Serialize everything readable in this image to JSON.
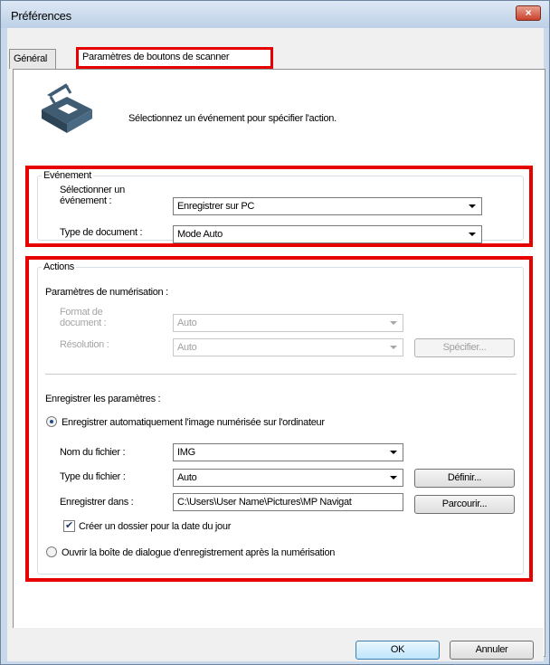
{
  "window": {
    "title": "Préférences",
    "close_symbol": "×"
  },
  "tabs": [
    {
      "label": "Général"
    },
    {
      "label": "Paramètres de boutons de scanner"
    }
  ],
  "intro_text": "Sélectionnez un événement pour spécifier l'action.",
  "event_group": {
    "title": "Evénement",
    "select_event_label_1": "Sélectionner un",
    "select_event_label_2": "événement :",
    "select_event_value": "Enregistrer sur PC",
    "doc_type_label": "Type de document :",
    "doc_type_value": "Mode Auto"
  },
  "actions_group": {
    "title": "Actions",
    "scan_settings_label": "Paramètres de numérisation :",
    "doc_format_label_1": "Format de",
    "doc_format_label_2": "document :",
    "doc_format_value": "Auto",
    "resolution_label": "Résolution :",
    "resolution_value": "Auto",
    "specify_button": "Spécifier...",
    "save_settings_label": "Enregistrer les paramètres :",
    "auto_save_radio": "Enregistrer automatiquement l'image numérisée sur l'ordinateur",
    "file_name_label": "Nom du fichier :",
    "file_name_value": "IMG",
    "file_type_label": "Type du fichier :",
    "file_type_value": "Auto",
    "define_button": "Définir...",
    "save_in_label": "Enregistrer dans :",
    "save_in_value": "C:\\Users\\User Name\\Pictures\\MP Navigat",
    "browse_button": "Parcourir...",
    "date_folder_checkbox": "Créer un dossier pour la date du jour",
    "date_folder_checked": true,
    "open_dialog_radio": "Ouvrir la boîte de dialogue d'enregistrement après la numérisation"
  },
  "footer": {
    "ok_button": "OK",
    "cancel_button": "Annuler"
  },
  "colors": {
    "highlight": "#e60000",
    "titlebar": "#c9d8ea"
  },
  "icons": {
    "scanner": "scanner-icon",
    "checkmark": "✔"
  }
}
